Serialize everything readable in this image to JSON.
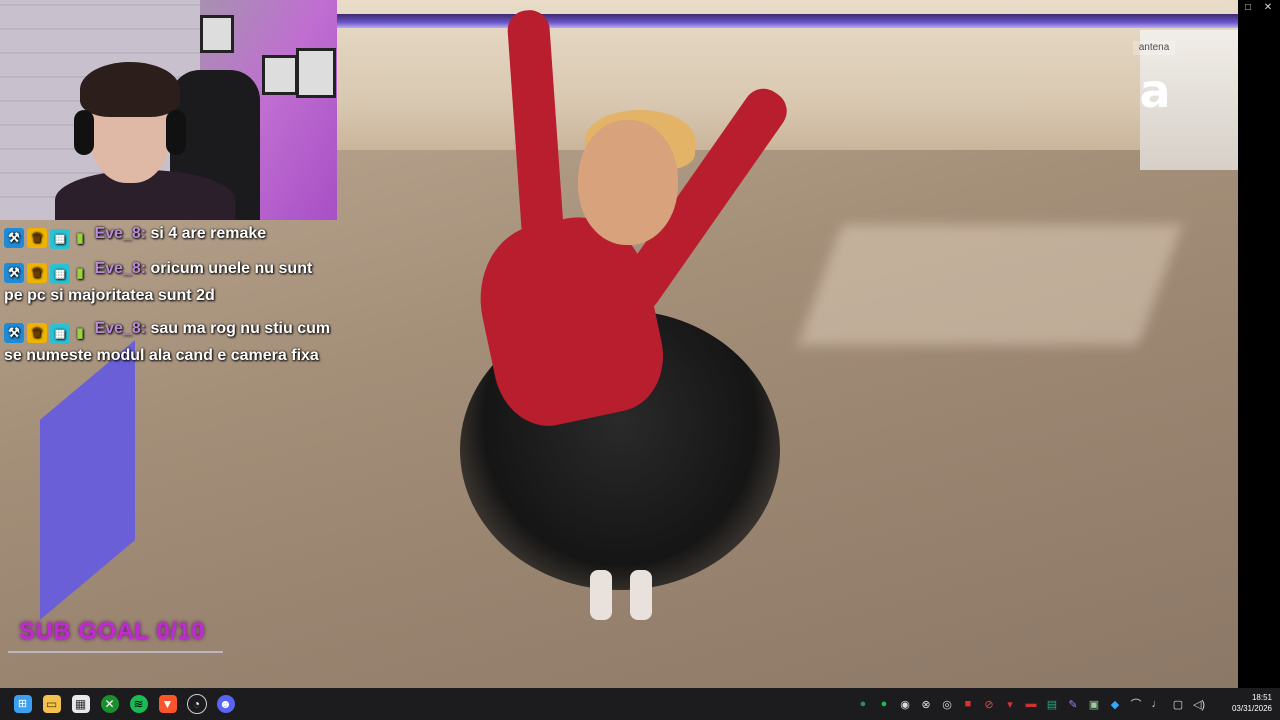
{
  "video": {
    "channel_text": "antena",
    "channel_logo": "a"
  },
  "window_controls": [
    {
      "name": "minimize",
      "glyph": "–"
    },
    {
      "name": "maximize",
      "glyph": "□"
    },
    {
      "name": "close",
      "glyph": "✕"
    }
  ],
  "chat": {
    "messages": [
      {
        "user": "Eve_8:",
        "text": "si 4 are remake"
      },
      {
        "user": "Eve_8:",
        "text": "oricum unele nu sunt pe pc si majoritatea sunt 2d"
      },
      {
        "user": "Eve_8:",
        "text": "sau ma rog nu stiu cum se numeste modul ala cand e camera fixa"
      }
    ],
    "badges": [
      "hammer-icon",
      "crown-icon",
      "sub-badge-icon",
      "battery-icon"
    ]
  },
  "sub_goal": {
    "label": "SUB GOAL 0/10"
  },
  "taskbar": {
    "apps": [
      "windows-start-icon",
      "file-explorer-icon",
      "store-icon",
      "xbox-icon",
      "spotify-icon",
      "brave-icon",
      "notification-app-icon",
      "discord-icon"
    ],
    "clock_time": "18:51",
    "clock_date": "03/31/2026"
  },
  "colors": {
    "sub_goal": "#c02ad1",
    "chat_username": "#b98bd6",
    "taskbar_bg": "#1c1c1e"
  }
}
